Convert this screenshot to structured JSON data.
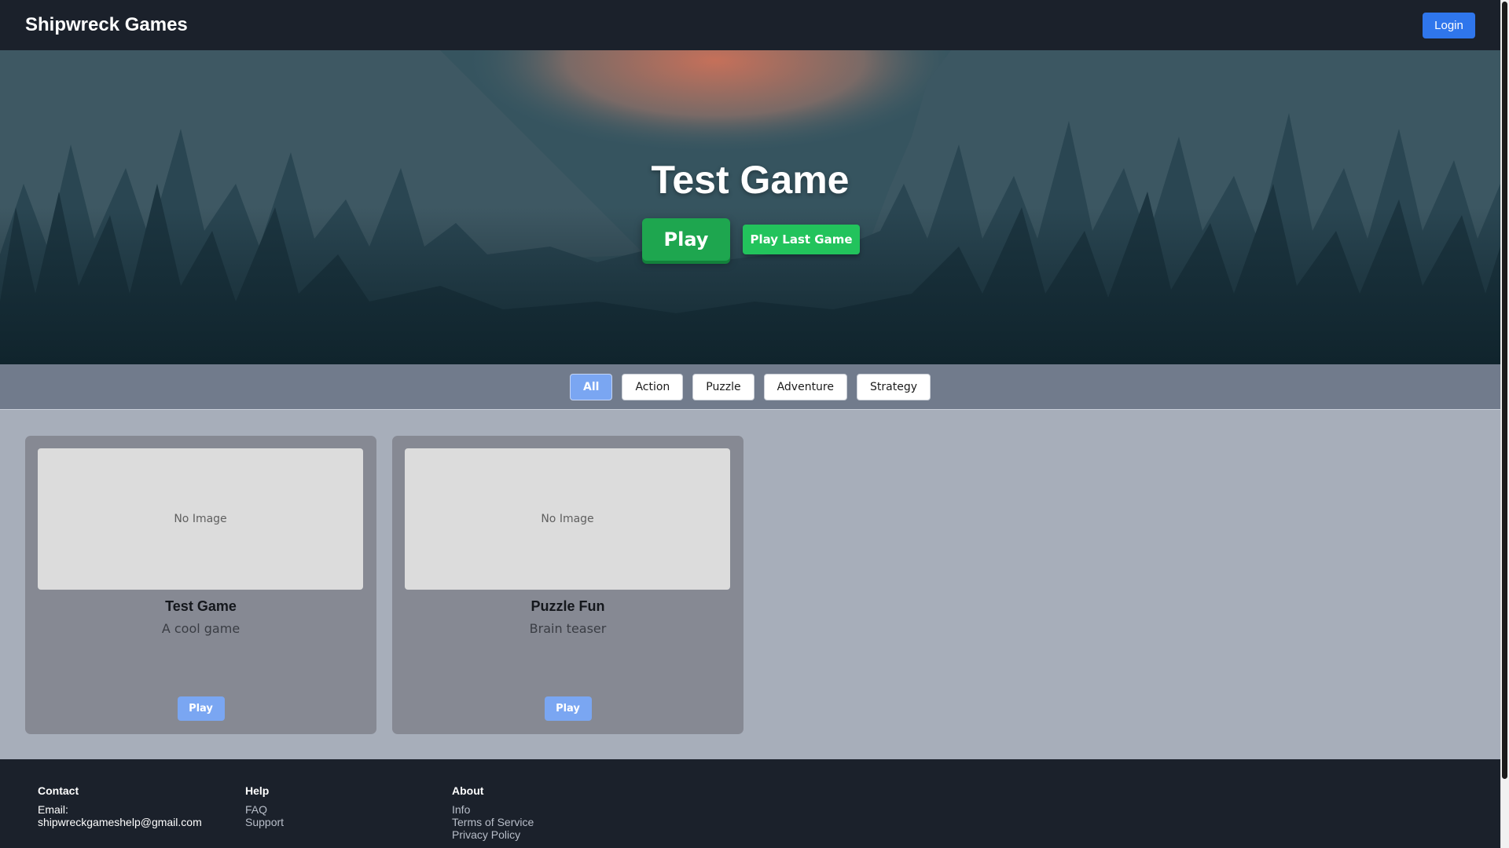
{
  "header": {
    "brand": "Shipwreck Games",
    "login_label": "Login"
  },
  "hero": {
    "title": "Test Game",
    "play_label": "Play",
    "play_last_label": "Play Last Game"
  },
  "filters": {
    "active": "All",
    "items": [
      "All",
      "Action",
      "Puzzle",
      "Adventure",
      "Strategy"
    ]
  },
  "games": [
    {
      "image_text": "No Image",
      "title": "Test Game",
      "description": "A cool game",
      "play_label": "Play"
    },
    {
      "image_text": "No Image",
      "title": "Puzzle Fun",
      "description": "Brain teaser",
      "play_label": "Play"
    }
  ],
  "footer": {
    "contact": {
      "heading": "Contact",
      "email_label": "Email:",
      "email": "shipwreckgameshelp@gmail.com"
    },
    "help": {
      "heading": "Help",
      "links": [
        "FAQ",
        "Support"
      ]
    },
    "about": {
      "heading": "About",
      "links": [
        "Info",
        "Terms of Service",
        "Privacy Policy"
      ]
    }
  },
  "colors": {
    "nav_bg": "#1b212b",
    "primary_blue": "#2f76ec",
    "play_green": "#1ea64f",
    "filter_active": "#7aa6f2",
    "page_bg": "#a7aeba",
    "card_bg": "#868993"
  }
}
